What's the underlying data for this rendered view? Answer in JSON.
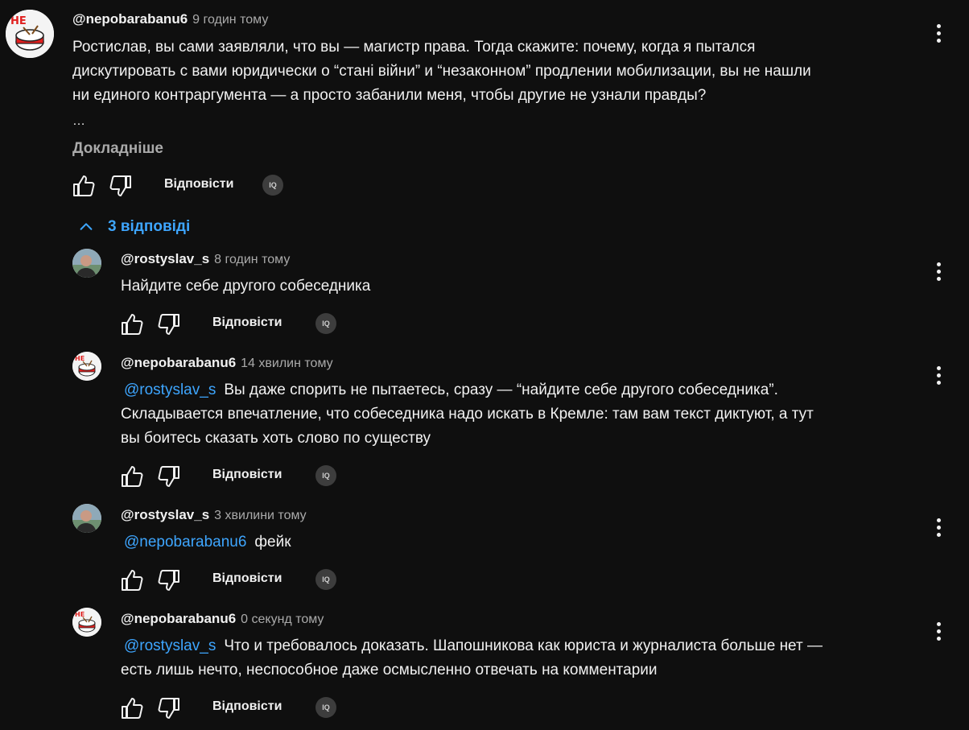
{
  "comment": {
    "author": "@nepobarabanu6",
    "time": "9 годин тому",
    "text_lines": [
      "Ростислав, вы сами заявляли, что вы — магистр права. Тогда скажите: почему, когда я пытался",
      "дискутировать с вами юридически о “стані війни” и “незаконном” продлении мобилизации, вы не нашли",
      "ни единого контраргумента — а просто забанили меня, чтобы другие не узнали правды?"
    ],
    "ellipsis": "…",
    "read_more": "Докладніше",
    "reply_label": "Відповісти",
    "badge": "IQ"
  },
  "replies_toggle": {
    "label": "3 відповіді",
    "icon": "chevron-up-icon"
  },
  "replies": [
    {
      "author": "@rostyslav_s",
      "time": "8 годин тому",
      "mention": "",
      "text_lines": [
        "Найдите себе другого собеседника"
      ],
      "reply_label": "Відповісти",
      "badge": "IQ"
    },
    {
      "author": "@nepobarabanu6",
      "time": "14 хвилин тому",
      "mention": "@rostyslav_s",
      "text_lines": [
        "Вы даже спорить не пытаетесь, сразу — “найдите себе другого собеседника”.",
        "Складывается впечатление, что собеседника надо искать в Кремле: там вам текст диктуют, а тут",
        "вы боитесь сказать хоть слово по существу"
      ],
      "reply_label": "Відповісти",
      "badge": "IQ"
    },
    {
      "author": "@rostyslav_s",
      "time": "3 хвилини тому",
      "mention": "@nepobarabanu6",
      "text_lines": [
        "фейк"
      ],
      "reply_label": "Відповісти",
      "badge": "IQ"
    },
    {
      "author": "@nepobarabanu6",
      "time": "0 секунд тому",
      "mention": "@rostyslav_s",
      "text_lines": [
        "Что и требовалось доказать. Шапошникова как юриста и журналиста больше нет —",
        "есть лишь нечто, неспособное даже осмысленно отвечать на комментарии"
      ],
      "reply_label": "Відповісти",
      "badge": "IQ"
    }
  ],
  "logo_text": "НЕ",
  "colors": {
    "background": "#0f0f0f",
    "text": "#f1f1f1",
    "secondary": "#aaaaaa",
    "link": "#3ea6ff",
    "logo_red": "#e0201f"
  }
}
